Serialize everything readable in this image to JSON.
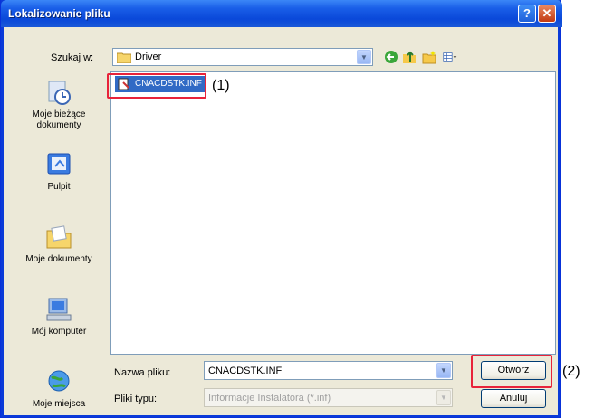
{
  "window": {
    "title": "Lokalizowanie pliku",
    "help_glyph": "?",
    "close_glyph": "✕"
  },
  "lookin": {
    "label": "Szukaj w:",
    "value": "Driver"
  },
  "places": [
    {
      "label": "Moje bieżące dokumenty",
      "icon": "recent-documents-icon"
    },
    {
      "label": "Pulpit",
      "icon": "desktop-icon"
    },
    {
      "label": "Moje dokumenty",
      "icon": "my-documents-icon"
    },
    {
      "label": "Mój komputer",
      "icon": "my-computer-icon"
    },
    {
      "label": "Moje miejsca",
      "icon": "network-places-icon"
    }
  ],
  "files": [
    {
      "name": "CNACDSTK.INF"
    }
  ],
  "filename": {
    "label": "Nazwa pliku:",
    "value": "CNACDSTK.INF"
  },
  "filetype": {
    "label": "Pliki typu:",
    "value": "Informacje Instalatora (*.inf)"
  },
  "buttons": {
    "open": "Otwórz",
    "cancel": "Anuluj"
  },
  "callouts": {
    "one": "(1)",
    "two": "(2)"
  },
  "colors": {
    "accent": "#e8233a",
    "selection": "#316ac5",
    "titlebar": "#0a48d9"
  }
}
